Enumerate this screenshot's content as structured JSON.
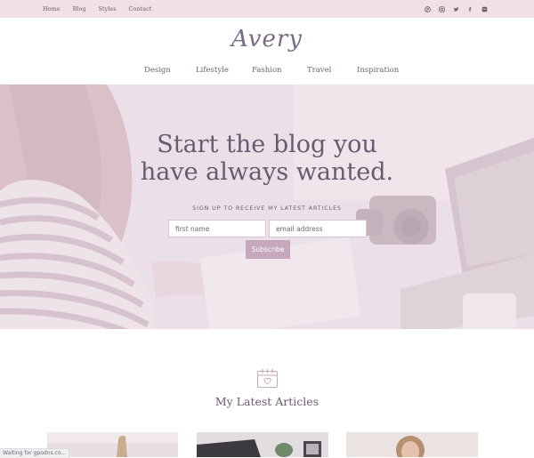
{
  "topbar": {
    "links": [
      "Home",
      "Blog",
      "Styles",
      "Contact"
    ],
    "social_icons": [
      "pinterest-icon",
      "instagram-icon",
      "twitter-icon",
      "facebook-icon",
      "email-icon"
    ]
  },
  "logo": "Avery",
  "nav": [
    "Design",
    "Lifestyle",
    "Fashion",
    "Travel",
    "Inspiration"
  ],
  "hero": {
    "title_line1": "Start the blog you",
    "title_line2": "have always wanted.",
    "subtitle": "SIGN UP TO RECEIVE MY LATEST ARTICLES",
    "first_name_placeholder": "first name",
    "email_placeholder": "email address",
    "button": "Subscribe"
  },
  "latest": {
    "icon": "calendar-heart-icon",
    "title": "My Latest Articles"
  },
  "status_bar": "Waiting for gpodns.co...",
  "colors": {
    "topbar_bg": "#f2e1e4",
    "accent": "#c7a7bb",
    "text": "#6b5a6e"
  }
}
